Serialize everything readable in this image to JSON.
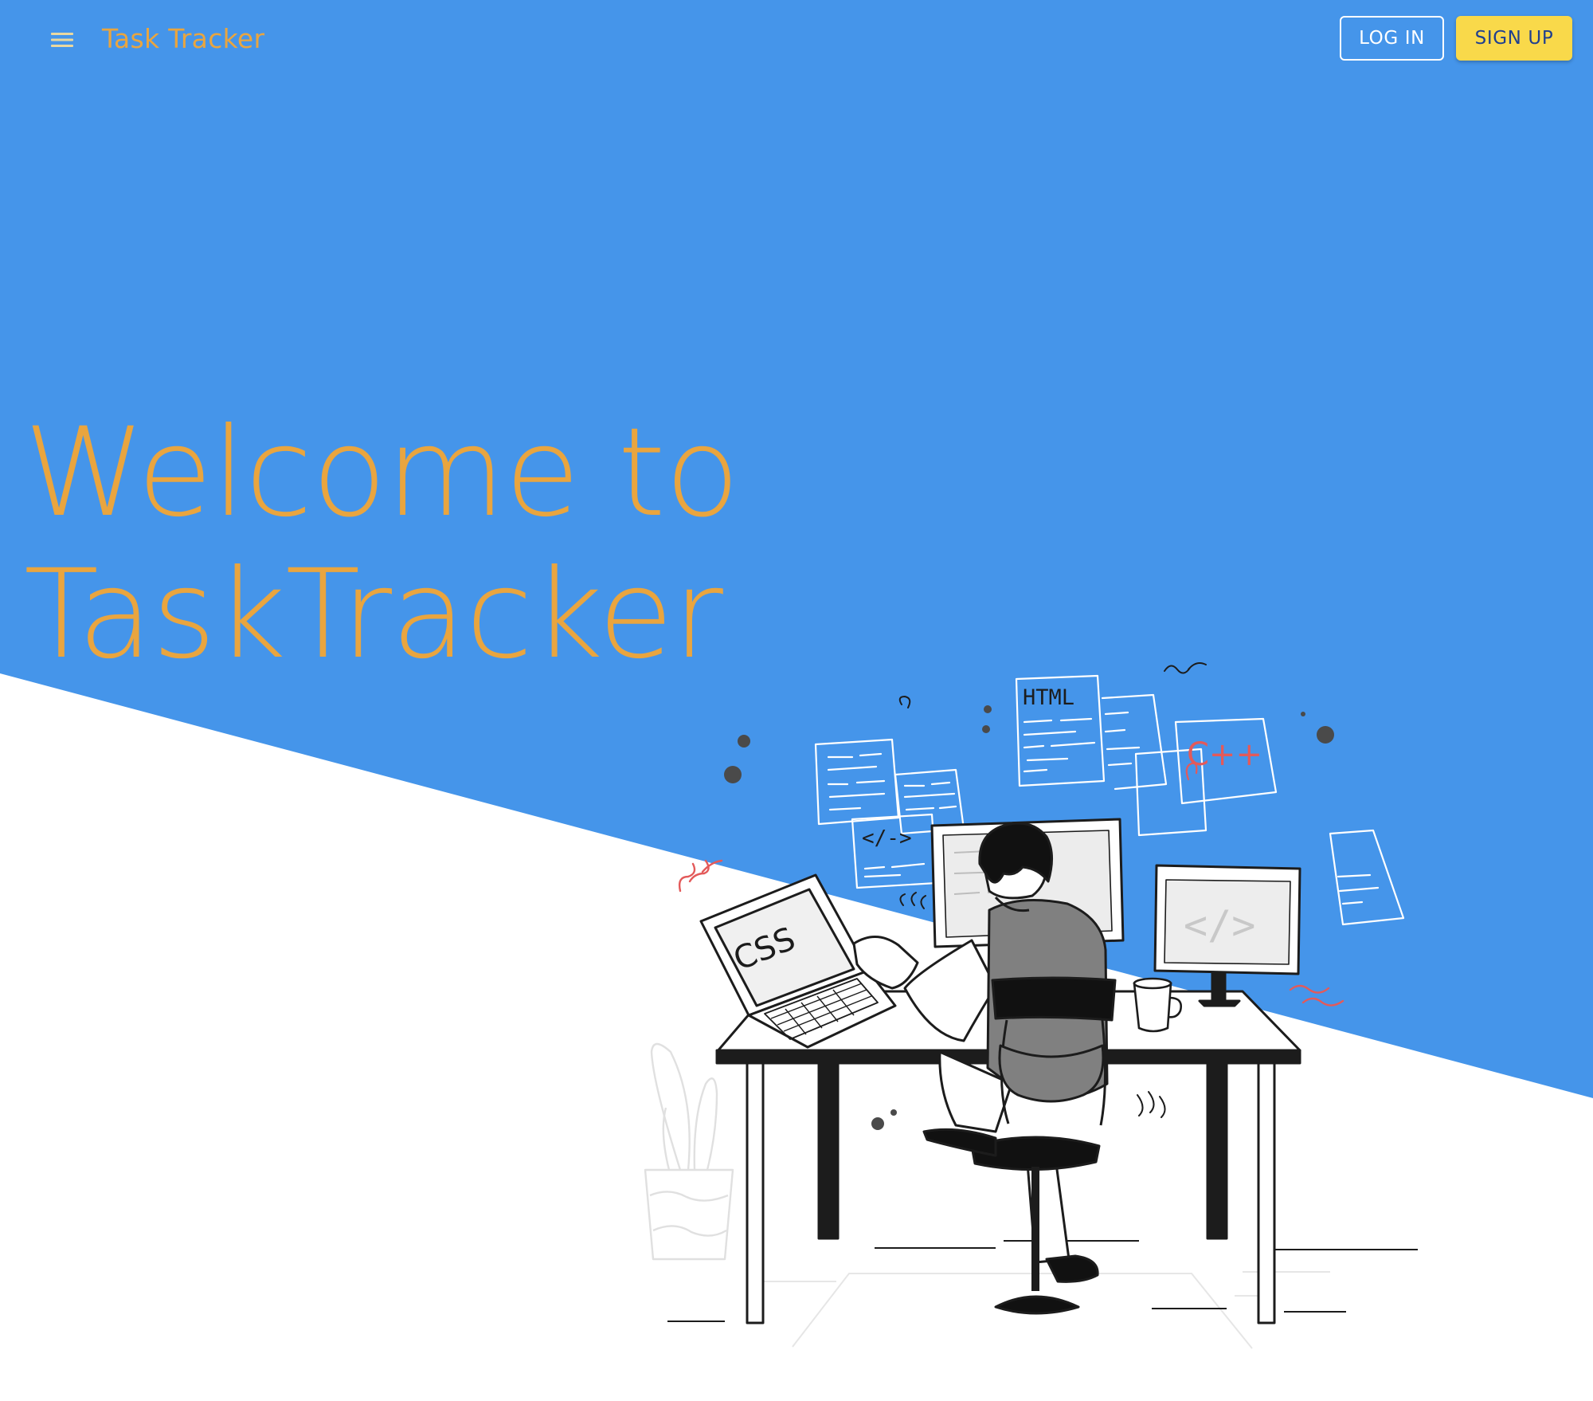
{
  "header": {
    "menu_icon": "hamburger-menu-icon",
    "brand": "Task Tracker",
    "login_label": "LOG IN",
    "signup_label": "SIGN UP"
  },
  "hero": {
    "title_line1": "Welcome to",
    "title_line2": "TaskTracker"
  },
  "illustration": {
    "labels": {
      "html": "HTML",
      "css": "CSS",
      "cpp": "C++",
      "tag1": "</->",
      "tag2": "</>"
    }
  },
  "colors": {
    "hero_blue": "#4595ea",
    "accent_orange": "#e9a53f",
    "signup_yellow": "#f9d94a",
    "signup_text": "#1f3f8f"
  }
}
